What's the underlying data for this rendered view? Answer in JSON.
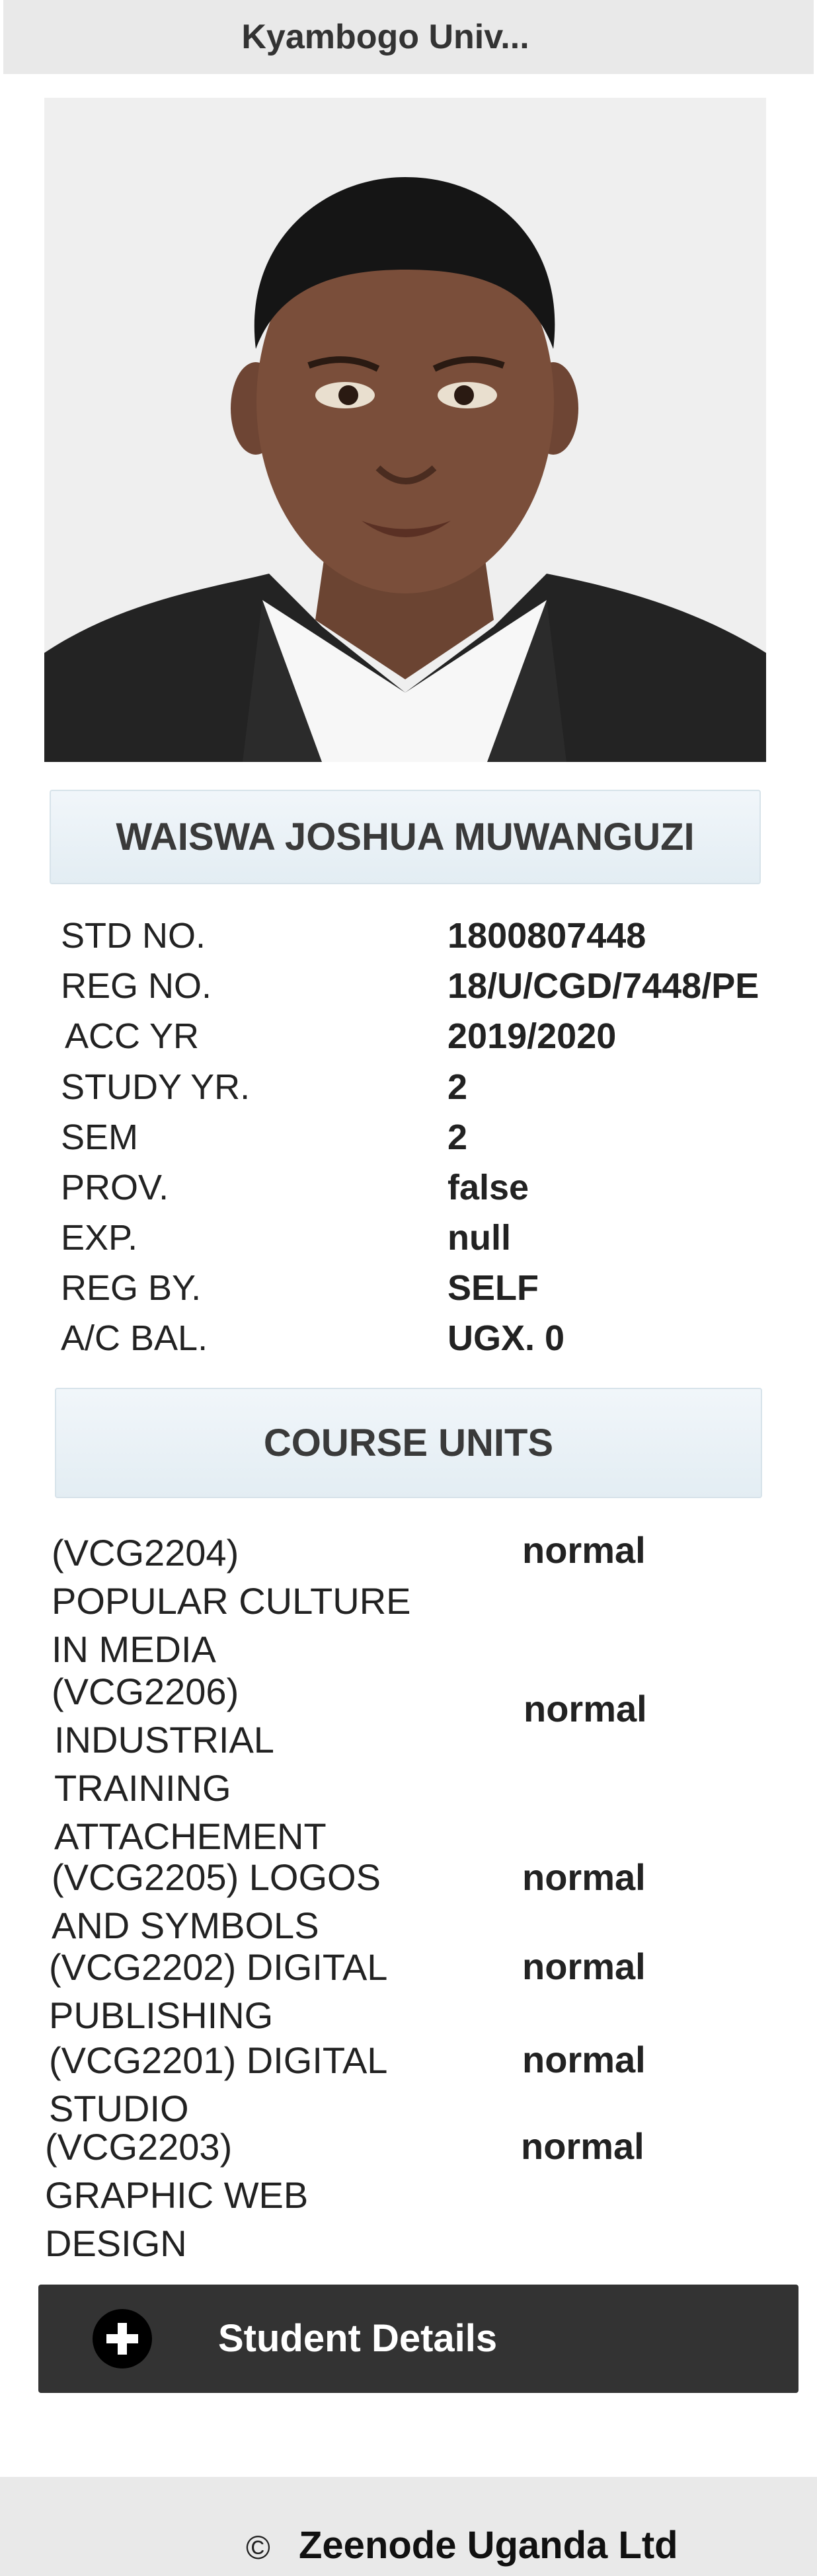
{
  "header": {
    "title": "Kyambogo Univ..."
  },
  "student": {
    "photo_icon": "student-photo",
    "name": "WAISWA JOSHUA MUWANGUZI",
    "fields": [
      {
        "label": "STD NO.",
        "value": "1800807448"
      },
      {
        "label": "REG NO.",
        "value": "18/U/CGD/7448/PE"
      },
      {
        "label": "ACC YR",
        "value": "2019/2020"
      },
      {
        "label": "STUDY YR.",
        "value": "2"
      },
      {
        "label": "SEM",
        "value": "2"
      },
      {
        "label": "PROV.",
        "value": "false"
      },
      {
        "label": "EXP.",
        "value": "null"
      },
      {
        "label": "REG BY.",
        "value": "SELF"
      },
      {
        "label": "A/C BAL.",
        "value": "UGX. 0"
      }
    ]
  },
  "course_units": {
    "heading": "COURSE UNITS",
    "items": [
      {
        "lines": [
          "(VCG2204)",
          "POPULAR CULTURE",
          "IN MEDIA"
        ],
        "status": "normal"
      },
      {
        "lines": [
          "(VCG2206)",
          "INDUSTRIAL",
          "TRAINING",
          "ATTACHEMENT"
        ],
        "status": "normal"
      },
      {
        "lines": [
          "(VCG2205) LOGOS",
          "AND SYMBOLS"
        ],
        "status": "normal"
      },
      {
        "lines": [
          "(VCG2202) DIGITAL",
          "PUBLISHING"
        ],
        "status": "normal"
      },
      {
        "lines": [
          "(VCG2201) DIGITAL",
          "STUDIO"
        ],
        "status": "normal"
      },
      {
        "lines": [
          "(VCG2203)",
          "GRAPHIC WEB",
          "DESIGN"
        ],
        "status": "normal"
      }
    ]
  },
  "actions": {
    "student_details_label": "Student Details",
    "icon": "plus-icon"
  },
  "footer": {
    "copyright_symbol": "©",
    "company": "Zeenode Uganda Ltd"
  },
  "colors": {
    "button_bg": "#333333",
    "header_bg": "#e9e9e9",
    "box_bg": "#e8f0f5"
  }
}
